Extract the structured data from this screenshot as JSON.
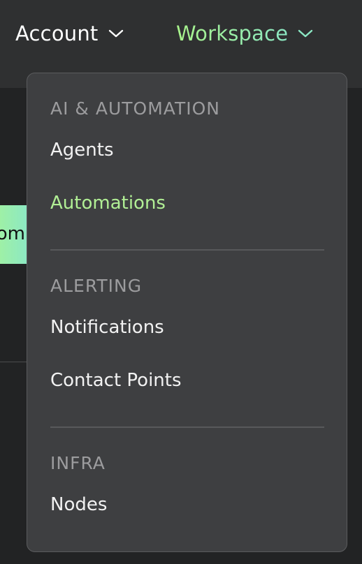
{
  "topnav": {
    "account_label": "Account",
    "workspace_label": "Workspace"
  },
  "background": {
    "partial_button_text": "om"
  },
  "menu": {
    "sections": [
      {
        "title": "AI & AUTOMATION",
        "items": [
          {
            "label": "Agents"
          },
          {
            "label": "Automations",
            "active": true
          }
        ]
      },
      {
        "title": "ALERTING",
        "items": [
          {
            "label": "Notifications"
          },
          {
            "label": "Contact Points"
          }
        ]
      },
      {
        "title": "INFRA",
        "items": [
          {
            "label": "Nodes"
          }
        ]
      }
    ]
  },
  "colors": {
    "accent_green": "#b1ef95",
    "menu_bg": "#3e3f41",
    "topbar_bg": "#2f3031",
    "page_bg": "#222324"
  }
}
